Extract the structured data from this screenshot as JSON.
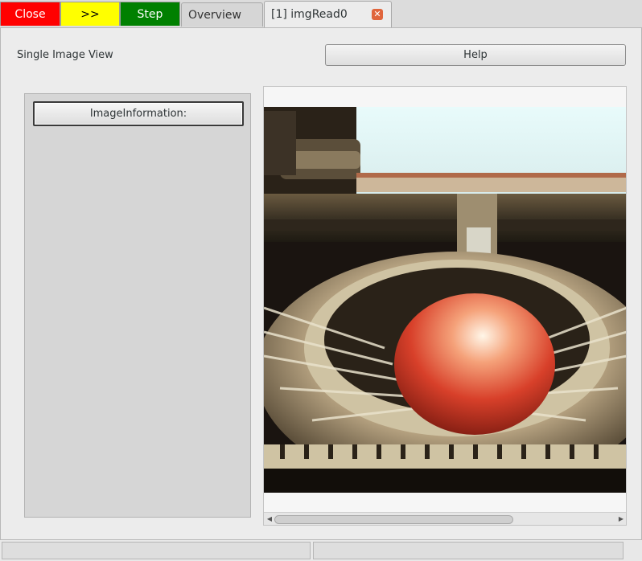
{
  "toolbar": {
    "close_label": "Close",
    "next_label": ">>",
    "step_label": "Step"
  },
  "tabs": [
    {
      "label": "Overview",
      "active": false
    },
    {
      "label": "[1] imgRead0",
      "active": true
    }
  ],
  "view": {
    "title": "Single Image View",
    "help_label": "Help",
    "info_button_label": "ImageInformation:"
  },
  "image": {
    "description_icon": "typewriter-photo"
  },
  "colors": {
    "close": "#ff0000",
    "next": "#ffff00",
    "step": "#008000"
  }
}
